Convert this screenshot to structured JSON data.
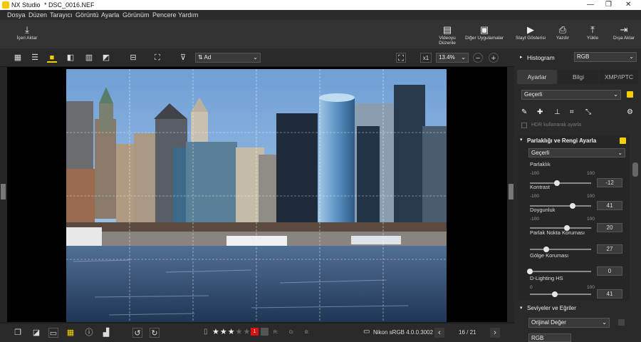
{
  "window": {
    "app_name": "NX Studio",
    "file_title": "* DSC_0016.NEF",
    "minimize": "—",
    "maximize": "❐",
    "close": "✕"
  },
  "menu": [
    "Dosya",
    "Düzen",
    "Tarayıcı",
    "Görüntü",
    "Ayarla",
    "Görünüm",
    "Pencere",
    "Yardım"
  ],
  "toolbar": {
    "import": "İçeri Aktar",
    "video_editor": "Videoyu Düzenle",
    "other_apps": "Diğer Uygulamalar",
    "slideshow": "Slayt Gösterisi",
    "print": "Yazdır",
    "upload": "Yükle",
    "export": "Dışa Aktar"
  },
  "viewbar": {
    "sort_value": "Ad",
    "fit_label": "x1",
    "zoom": "13.4%"
  },
  "bottombar": {
    "rating": 3,
    "max_rating": 5,
    "label_num": "1",
    "r": "R:",
    "g": "G:",
    "b": "B:",
    "color_profile": "Nikon sRGB 4.0.0.3002",
    "page": "16 / 21"
  },
  "panel": {
    "histogram": "Histogram",
    "histogram_mode": "RGB",
    "tabs": [
      "Ayarlar",
      "Bilgi",
      "XMP/IPTC"
    ],
    "preset": "Geçerli",
    "hdr_label": "HDR kullanarak ayarla",
    "section1_title": "Parlaklığı ve Rengi Ayarla",
    "section1_preset": "Geçerli",
    "sliders": [
      {
        "label": "Parlaklık",
        "min": "-100",
        "max": "100",
        "value": "-12",
        "fraction": 0.44
      },
      {
        "label": "Kontrast",
        "min": "-100",
        "max": "100",
        "value": "41",
        "fraction": 0.7
      },
      {
        "label": "Doygunluk",
        "min": "-100",
        "max": "100",
        "value": "20",
        "fraction": 0.6
      },
      {
        "label": "Parlak Nokta Koruması",
        "min": "",
        "max": "",
        "value": "27",
        "fraction": 0.27
      },
      {
        "label": "Gölge Koruması",
        "min": "",
        "max": "",
        "value": "0",
        "fraction": 0.0
      },
      {
        "label": "D-Lighting HS",
        "min": "0",
        "max": "100",
        "value": "41",
        "fraction": 0.41
      }
    ],
    "section2_title": "Seviyeler ve Eğriler",
    "section2_preset": "Orijinal Değer",
    "section2_channel": "RGB"
  },
  "colors": {
    "accent": "#f5d000",
    "panel_bg": "#2a2a2a",
    "viewer_bg": "#000000"
  }
}
